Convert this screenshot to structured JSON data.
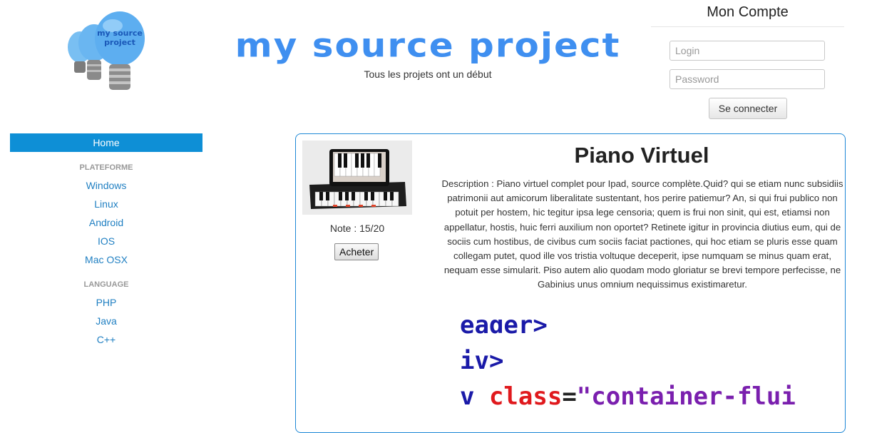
{
  "header": {
    "brand_title": "my source project",
    "brand_subtitle": "Tous les projets ont un début",
    "logo_text_line1": "my source",
    "logo_text_line2": "project"
  },
  "account": {
    "title": "Mon Compte",
    "login_placeholder": "Login",
    "password_placeholder": "Password",
    "submit_label": "Se connecter"
  },
  "sidebar": {
    "home_label": "Home",
    "sections": [
      {
        "header": "PLATEFORME",
        "items": [
          "Windows",
          "Linux",
          "Android",
          "IOS",
          "Mac OSX"
        ]
      },
      {
        "header": "LANGUAGE",
        "items": [
          "PHP",
          "Java",
          "C++"
        ]
      }
    ]
  },
  "product": {
    "title": "Piano Virtuel",
    "note": "Note : 15/20",
    "buy_label": "Acheter",
    "description": "Description : Piano virtuel complet pour Ipad, source complète.Quid? qui se etiam nunc subsidiis patrimonii aut amicorum liberalitate sustentant, hos perire patiemur? An, si qui frui publico non potuit per hostem, hic tegitur ipsa lege censoria; quem is frui non sinit, qui est, etiamsi non appellatur, hostis, huic ferri auxilium non oportet? Retinete igitur in provincia diutius eum, qui de sociis cum hostibus, de civibus cum sociis faciat pactiones, qui hoc etiam se pluris esse quam collegam putet, quod ille vos tristia voltuque deceperit, ipse numquam se minus quam erat, nequam esse simularit. Piso autem alio quodam modo gloriatur se brevi tempore perfecisse, ne Gabinius unus omnium nequissimus existimaretur.",
    "code_lines": [
      "eader>",
      "iv>",
      "v class=\"container-flui"
    ]
  },
  "colors": {
    "accent": "#0e8fd6",
    "brand": "#3f8ff0",
    "link": "#1f7fc2",
    "panel_border": "#1e88d6"
  }
}
